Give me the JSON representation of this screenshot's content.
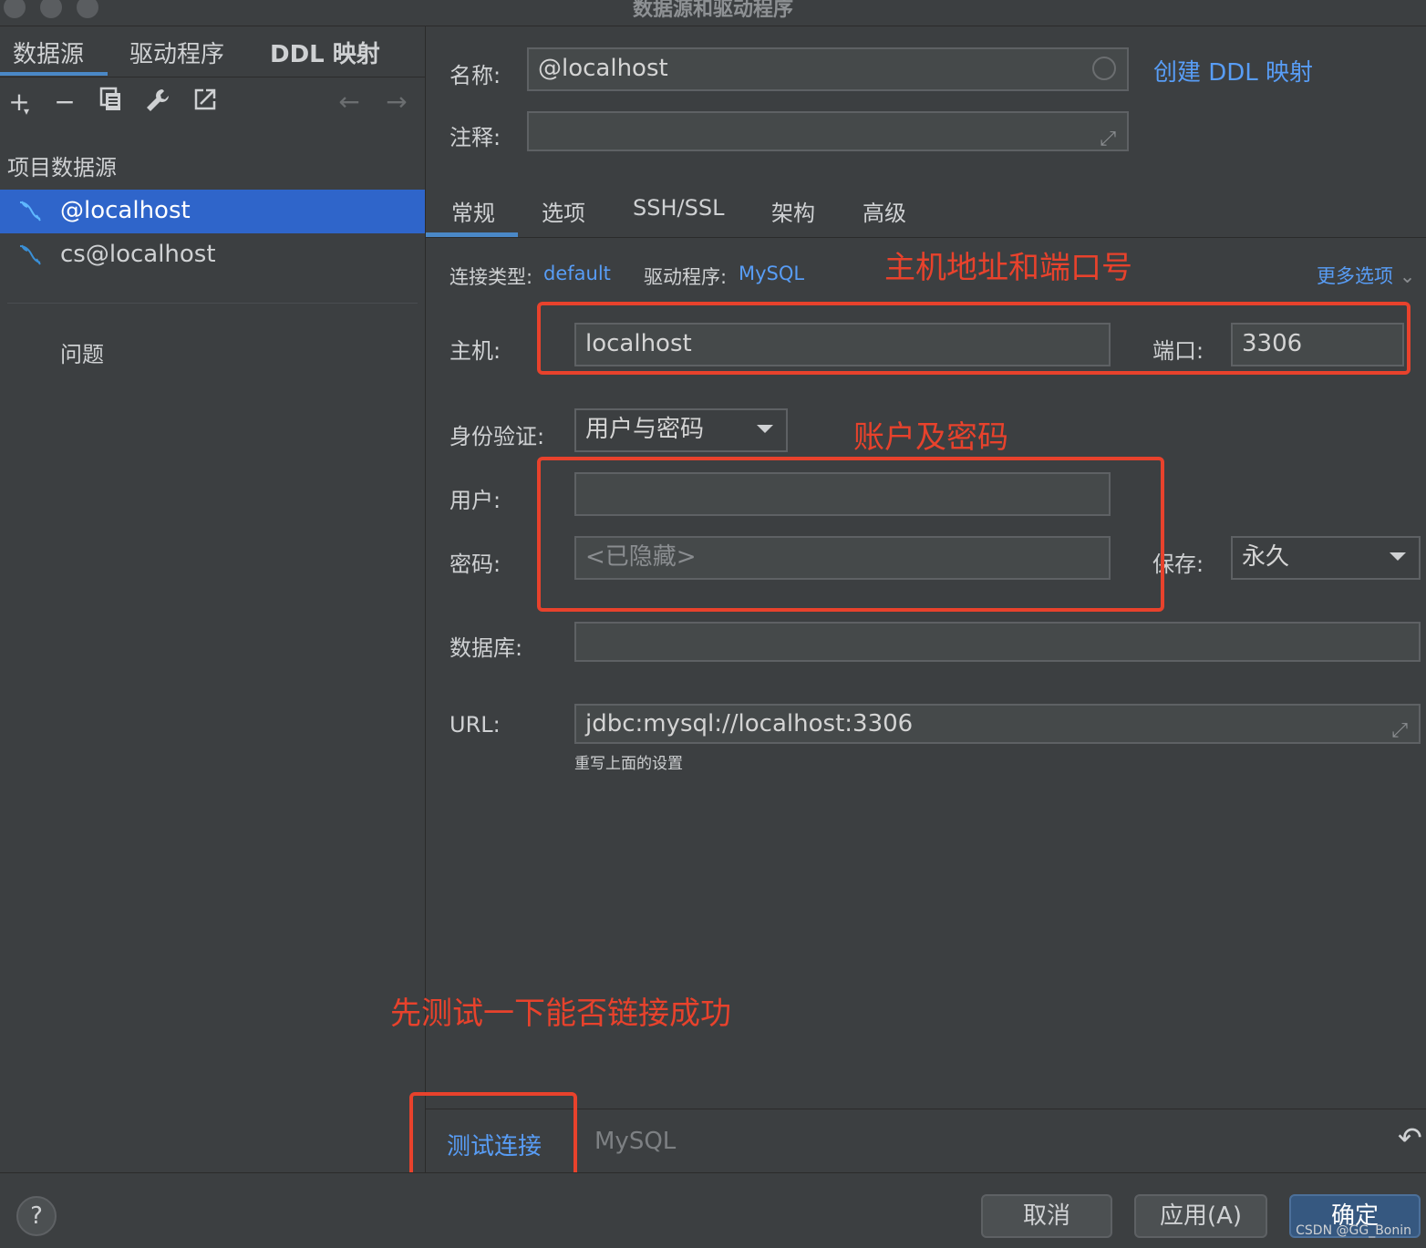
{
  "window": {
    "title": "数据源和驱动程序"
  },
  "left": {
    "tabs": [
      "数据源",
      "驱动程序",
      "DDL 映射"
    ],
    "toolbar": [
      "add-icon",
      "remove-icon",
      "copy-icon",
      "wrench-icon",
      "export-icon",
      "back-arrow-icon",
      "forward-arrow-icon"
    ],
    "section_label": "项目数据源",
    "datasources": [
      "@localhost",
      "cs@localhost"
    ],
    "problems": "问题"
  },
  "form": {
    "name_label": "名称:",
    "name_value": "@localhost",
    "create_ddl_link": "创建 DDL 映射",
    "comment_label": "注释:",
    "comment_value": "",
    "tabs": [
      "常规",
      "选项",
      "SSH/SSL",
      "架构",
      "高级"
    ],
    "conn_type_label": "连接类型:",
    "conn_type_value": "default",
    "driver_label": "驱动程序:",
    "driver_value": "MySQL",
    "more_options": "更多选项",
    "host_label": "主机:",
    "host_value": "localhost",
    "port_label": "端口:",
    "port_value": "3306",
    "auth_label": "身份验证:",
    "auth_value": "用户与密码",
    "user_label": "用户:",
    "user_value": "",
    "password_label": "密码:",
    "password_placeholder": "<已隐藏>",
    "save_label": "保存:",
    "save_value": "永久",
    "database_label": "数据库:",
    "database_value": "",
    "url_label": "URL:",
    "url_value": "jdbc:mysql://localhost:3306",
    "url_hint": "重写上面的设置"
  },
  "annotations": {
    "host_port": "主机地址和端口号",
    "account": "账户及密码",
    "test_first": "先测试一下能否链接成功"
  },
  "bottom": {
    "test_connection": "测试连接",
    "driver_name": "MySQL"
  },
  "footer": {
    "help": "?",
    "cancel": "取消",
    "apply": "应用(A)",
    "ok": "确定",
    "watermark": "CSDN @GG_Bonin"
  },
  "colors": {
    "background": "#3c3f41",
    "selection": "#2f65ca",
    "link": "#589df6",
    "annotation": "#e8422c"
  }
}
